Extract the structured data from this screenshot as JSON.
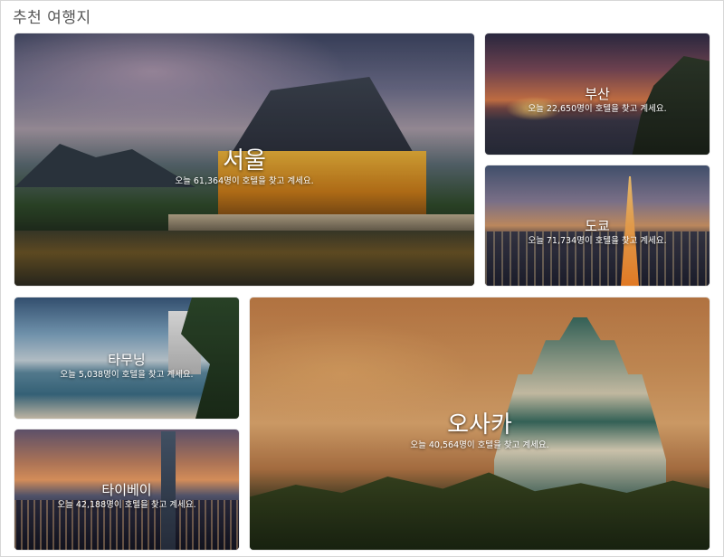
{
  "section": {
    "title": "추천 여행지"
  },
  "cards": [
    {
      "city": "서울",
      "subtitle": "오늘 61,364명이 호텔을 찾고 계세요."
    },
    {
      "city": "부산",
      "subtitle": "오늘 22,650명이 호텔을 찾고 계세요."
    },
    {
      "city": "도쿄",
      "subtitle": "오늘 71,734명이 호텔을 찾고 계세요."
    },
    {
      "city": "타무닝",
      "subtitle": "오늘 5,038명이 호텔을 찾고 계세요."
    },
    {
      "city": "타이베이",
      "subtitle": "오늘 42,188명이 호텔을 찾고 계세요."
    },
    {
      "city": "오사카",
      "subtitle": "오늘 40,564명이 호텔을 찾고 계세요."
    }
  ]
}
